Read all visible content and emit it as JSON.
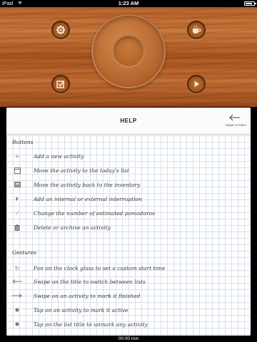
{
  "status_bar": {
    "carrier": "iPad",
    "time": "1:23 AM"
  },
  "controls": {
    "settings_icon": "gear-icon",
    "coffee_icon": "coffee-cup-icon",
    "check_icon": "checkbox-icon",
    "play_icon": "play-icon"
  },
  "help": {
    "title": "HELP",
    "swipe_hint": "Swipe to leave",
    "sections": [
      {
        "title": "Buttons",
        "items": [
          {
            "icon": "plus-icon",
            "text": "Add a new activity"
          },
          {
            "icon": "calendar-icon",
            "text": "Move the activity to the today's list"
          },
          {
            "icon": "inbox-icon",
            "text": "Move the activity back to the inventory"
          },
          {
            "icon": "interruption-icon",
            "text": "Add an internal or external interruption"
          },
          {
            "icon": "estimate-icon",
            "text": "Change the number of estimated pomodoros"
          },
          {
            "icon": "trash-icon",
            "text": "Delete or archive an activity"
          }
        ]
      },
      {
        "title": "Gestures",
        "items": [
          {
            "icon": "rotate-icon",
            "text": "Pan on the clock glass to set a custom start time"
          },
          {
            "icon": "arrow-left-icon",
            "text": "Swipe on the title to switch between lists"
          },
          {
            "icon": "arrow-right-icon",
            "text": "Swipe on an activity to mark it finished"
          },
          {
            "icon": "tap-dot-icon",
            "text": "Tap on an activity to mark it active"
          },
          {
            "icon": "tap-dot-icon",
            "text": "Tap on the list title to unmark any activity"
          }
        ]
      }
    ]
  },
  "bottom_bar": {
    "timer": "00:00 min"
  }
}
